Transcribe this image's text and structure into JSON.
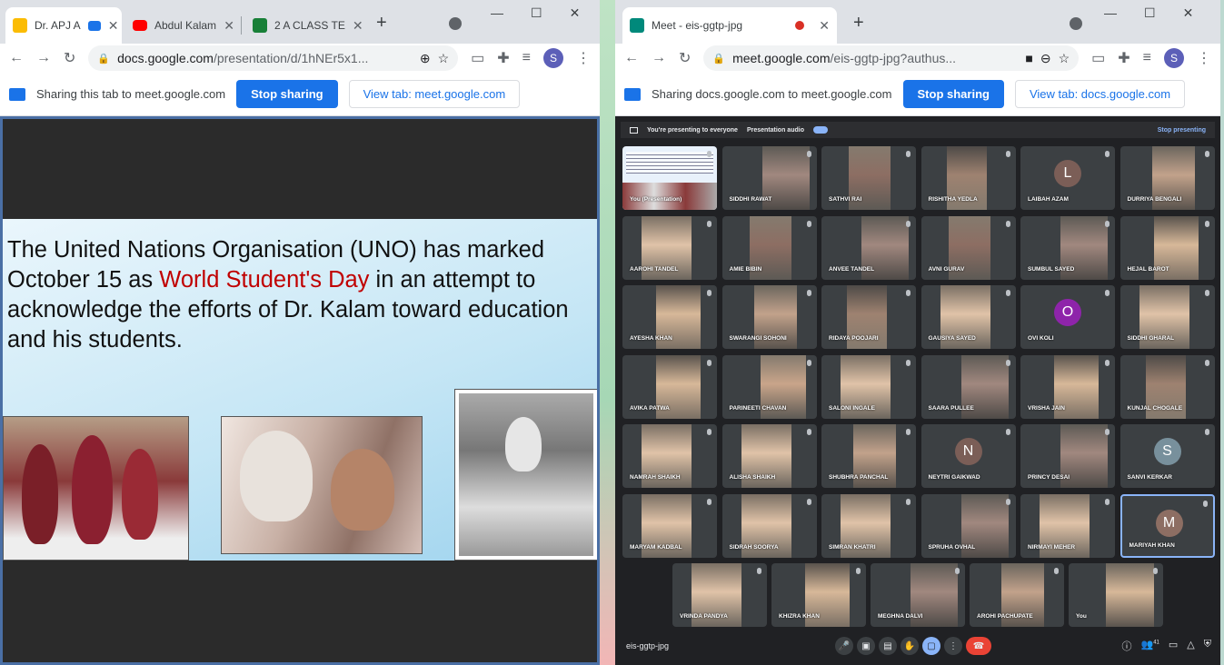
{
  "left": {
    "tabs": [
      {
        "title": "Dr. APJ A",
        "color": "#fbbc04"
      },
      {
        "title": "Abdul Kalam",
        "color": "#ff0000"
      },
      {
        "title": "2 A CLASS TE",
        "color": "#188038"
      }
    ],
    "url_host": "docs.google.com",
    "url_path": "/presentation/d/1hNEr5x1...",
    "avatar": "S",
    "sharing_text": "Sharing this tab to meet.google.com",
    "stop_sharing": "Stop sharing",
    "view_tab": "View tab: meet.google.com",
    "slide": {
      "text_before": "The United Nations Organisation (UNO) has marked October 15 as ",
      "highlight": "World Student's Day",
      "text_after": " in an attempt to acknowledge the efforts of Dr. Kalam toward education and his students."
    }
  },
  "right": {
    "tab_title": "Meet - eis-ggtp-jpg",
    "url_host": "meet.google.com",
    "url_path": "/eis-ggtp-jpg?authus...",
    "avatar": "S",
    "sharing_text": "Sharing docs.google.com to meet.google.com",
    "stop_sharing": "Stop sharing",
    "view_tab": "View tab: docs.google.com",
    "present_text": "You're presenting to everyone",
    "present_audio": "Presentation audio",
    "stop_presenting": "Stop presenting",
    "presentation_label": "You (Presentation)",
    "meeting_code": "eis-ggtp-jpg",
    "participant_count": "41",
    "participants": [
      [
        "",
        "SIDDHI RAWAT",
        "SATHVI RAI",
        "RISHITHA YEDLA",
        "LAIBAH AZAM",
        "DURRIYA BENGALI"
      ],
      [
        "AAROHI TANDEL",
        "AMIE BIBIN",
        "ANVEE TANDEL",
        "AVNI GURAV",
        "SUMBUL SAYED",
        "HEJAL BAROT"
      ],
      [
        "AYESHA KHAN",
        "SWARANGI SOHONI",
        "RIDAYA POOJARI",
        "GAUSIYA SAYED",
        "OVI KOLI",
        "SIDDHI GHARAL"
      ],
      [
        "AVIKA PATWA",
        "PARINEETI CHAVAN",
        "SALONI INGALE",
        "SAARA PULLEE",
        "VRISHA JAIN",
        "KUNJAL CHOGALE"
      ],
      [
        "NAMRAH SHAIKH",
        "ALISHA SHAIKH",
        "SHUBHRA PANCHAL",
        "NEYTRI GAIKWAD",
        "PRINCY DESAI",
        "SANVI KERKAR"
      ],
      [
        "MARYAM KADBAL",
        "SIDRAH SOORYA",
        "SIMRAN KHATRI",
        "SPRUHA OVHAL",
        "NIRMAYI MEHER",
        "MARIYAH KHAN"
      ]
    ],
    "last_row": [
      "VRINDA PANDYA",
      "KHIZRA KHAN",
      "MEGHNA DALVI",
      "AROHI PACHUPATE",
      "You"
    ],
    "initials": {
      "LAIBAH AZAM": "L",
      "OVI KOLI": "O",
      "NEYTRI GAIKWAD": "N",
      "SANVI KERKAR": "S",
      "MARIYAH KHAN": "M"
    },
    "initial_colors": {
      "L": "#7b5e57",
      "O": "#8e24aa",
      "N": "#7b5e57",
      "S": "#78909c",
      "M": "#8d6e63"
    }
  }
}
